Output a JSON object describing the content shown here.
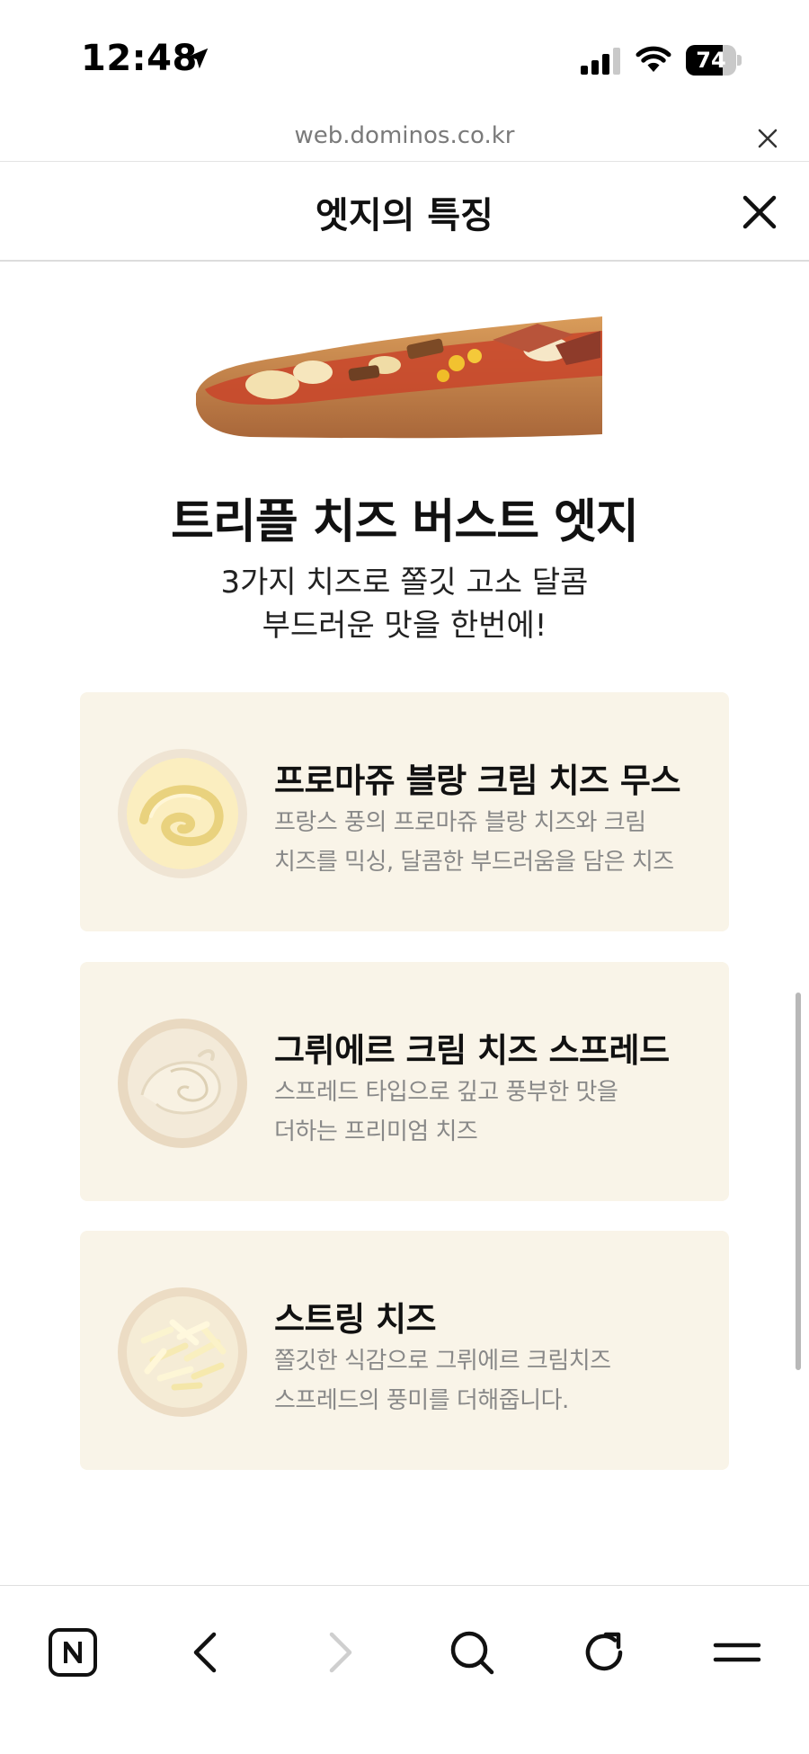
{
  "status_bar": {
    "time": "12:48",
    "battery": "74",
    "battery_level": 0.74,
    "location_icon": "location-arrow-icon",
    "signal_icon": "cellular-signal-icon",
    "wifi_icon": "wifi-icon"
  },
  "browser": {
    "url": "web.dominos.co.kr",
    "close_icon": "close-icon"
  },
  "modal": {
    "title": "엣지의 특징",
    "close_icon": "close-icon"
  },
  "feature": {
    "image": "pizza-edge-image",
    "title": "트리플 치즈 버스트 엣지",
    "subtitle_line1": "3가지 치즈로 쫄깃 고소 달콤",
    "subtitle_line2": "부드러운 맛을 한번에!"
  },
  "cheeses": [
    {
      "image": "fromage-blanc-cream-cheese-mousse-image",
      "title": "프로마쥬 블랑 크림 치즈 무스",
      "desc_line1": "프랑스 풍의 프로마쥬 블랑 치즈와 크림",
      "desc_line2": "치즈를 믹싱, 달콤한 부드러움을 담은 치즈"
    },
    {
      "image": "gruyere-cream-cheese-spread-image",
      "title": "그뤼에르 크림 치즈 스프레드",
      "desc_line1": "스프레드 타입으로 깊고 풍부한 맛을",
      "desc_line2": "더하는 프리미엄 치즈"
    },
    {
      "image": "string-cheese-image",
      "title": "스트링 치즈",
      "desc_line1": "쫄깃한 식감으로 그뤼에르 크림치즈",
      "desc_line2": "스프레드의 풍미를 더해줍니다."
    }
  ],
  "toolbar": {
    "items": [
      "naver-home-icon",
      "back-icon",
      "forward-icon",
      "search-icon",
      "reload-icon",
      "menu-icon"
    ]
  },
  "colors": {
    "card_background": "#f9f4e8",
    "description_text": "#888888",
    "disabled_icon": "#cfcfcf"
  }
}
